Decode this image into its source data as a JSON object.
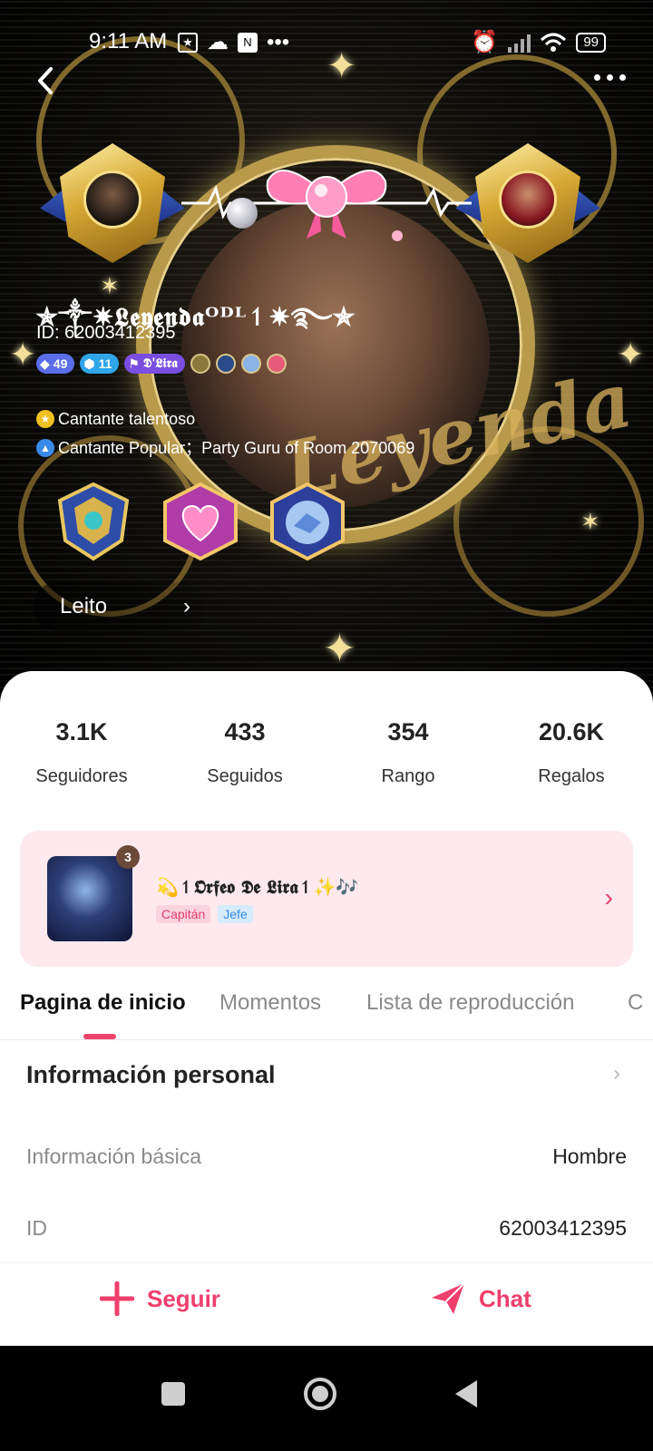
{
  "status_bar": {
    "time": "9:11 AM",
    "battery": "99",
    "dots": "•••"
  },
  "profile": {
    "name": "✯༒✷𝕷𝖊𝖞𝖊𝖓𝖉𝖆ᴼᴰᴸ↿✷࿐✯",
    "id_label": "ID: 62003412395",
    "badges": [
      {
        "icon": "diamond-icon",
        "value": "49",
        "color": "#5b6ee8"
      },
      {
        "icon": "gem-icon",
        "value": "11",
        "color": "#2fa6e8"
      },
      {
        "icon": "family-icon",
        "value": "𝕯'𝕷𝖎𝖗𝖆",
        "color": "#7a4ee0"
      }
    ],
    "titles": [
      "Cantante talentoso",
      "Cantante Popular；Party Guru of Room 2070069"
    ],
    "room_button": "Leito",
    "watermark": "Leyenda"
  },
  "stats": [
    {
      "value": "3.1K",
      "label": "Seguidores"
    },
    {
      "value": "433",
      "label": "Seguidos"
    },
    {
      "value": "354",
      "label": "Rango"
    },
    {
      "value": "20.6K",
      "label": "Regalos"
    }
  ],
  "family": {
    "name": "💫↿𝕺𝖗𝖋𝖊𝖔 𝕯𝖊 𝕷𝖎𝖗𝖆↿✨🎶",
    "level": "3",
    "tags": [
      "Capitán",
      "Jefe"
    ]
  },
  "tabs": [
    "Pagina de inicio",
    "Momentos",
    "Lista de reproducción",
    "C"
  ],
  "personal": {
    "title": "Información personal",
    "rows": [
      {
        "label": "Información básica",
        "value": "Hombre"
      },
      {
        "label": "ID",
        "value": "62003412395"
      }
    ]
  },
  "actions": {
    "follow": "Seguir",
    "chat": "Chat"
  },
  "colors": {
    "accent": "#ef3f6c",
    "tag_captain_bg": "#fbd3de",
    "tag_boss_bg": "#d6ebfb"
  }
}
